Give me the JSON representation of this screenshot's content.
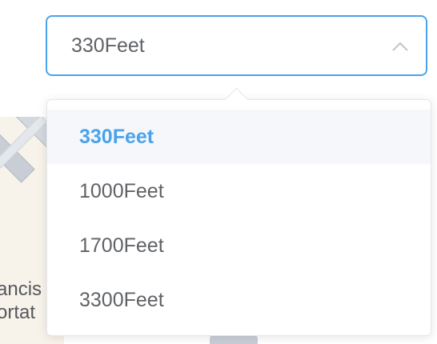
{
  "map": {
    "labels": [
      "ancis",
      "ortat"
    ]
  },
  "select": {
    "value": "330Feet",
    "options": [
      {
        "label": "330Feet",
        "selected": true
      },
      {
        "label": "1000Feet",
        "selected": false
      },
      {
        "label": "1700Feet",
        "selected": false
      },
      {
        "label": "3300Feet",
        "selected": false
      }
    ]
  },
  "colors": {
    "accent": "#4aa3ea",
    "text": "#5f6266",
    "selected_bg": "#f5f7fa"
  },
  "icons": {
    "chevron": "chevron-up-icon"
  }
}
